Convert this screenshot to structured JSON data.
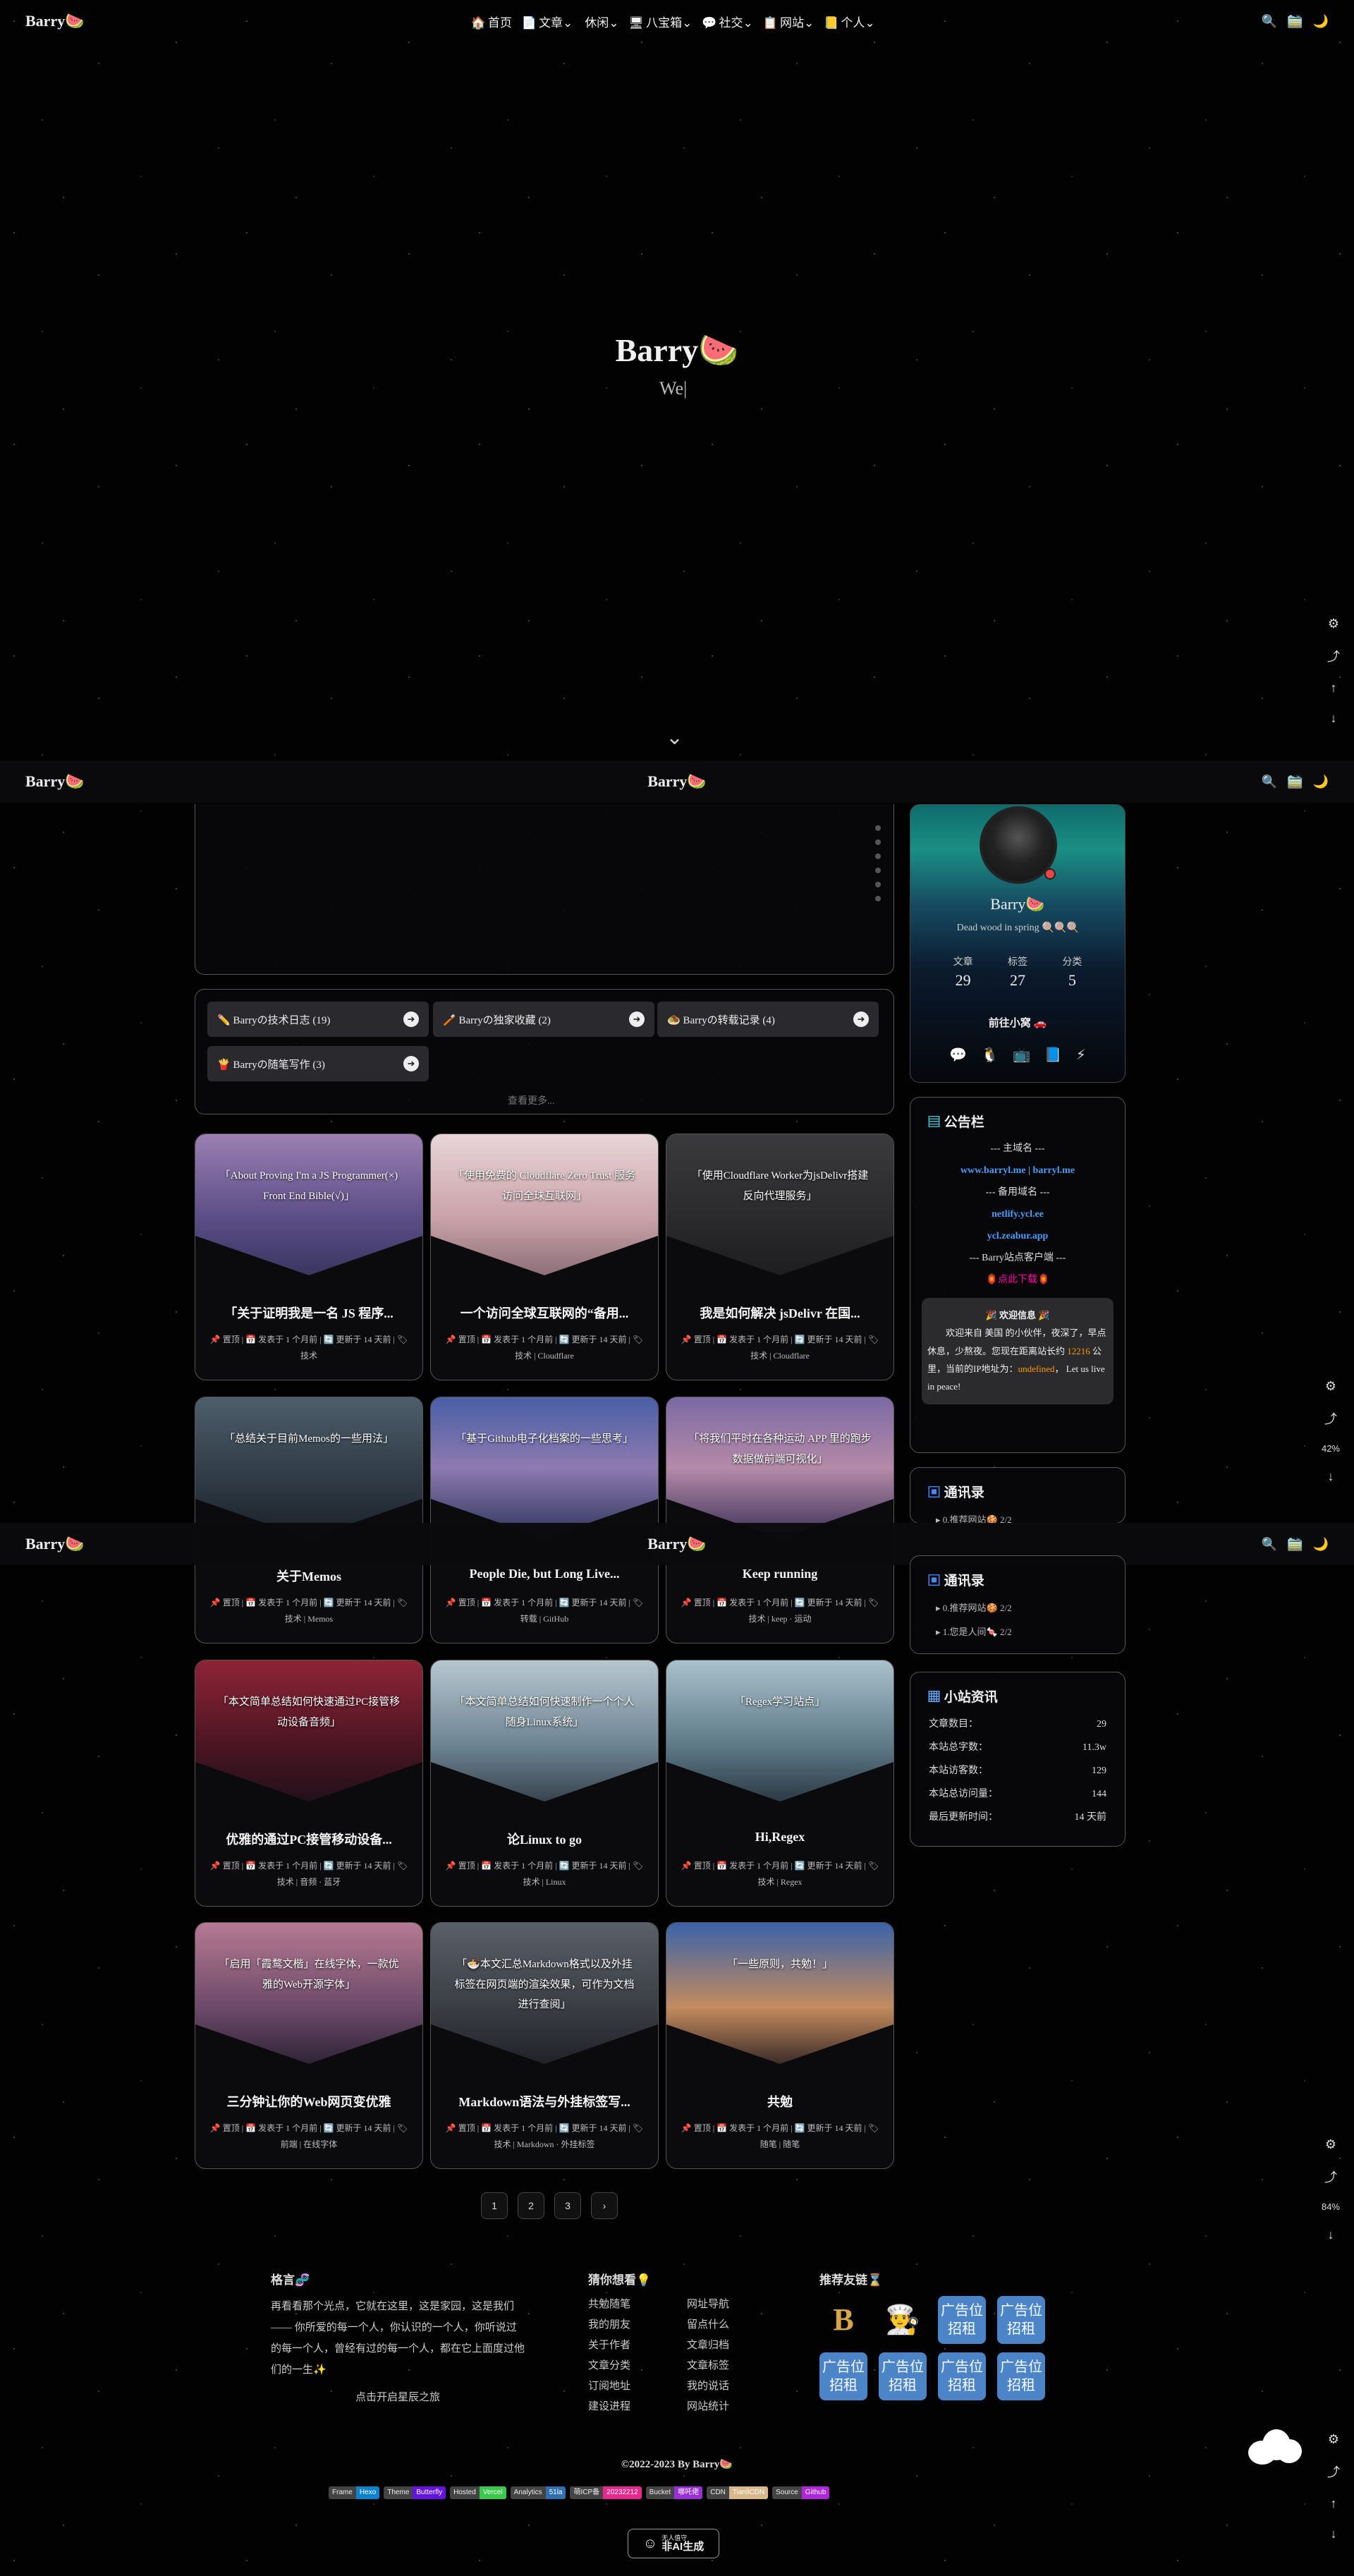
{
  "brand": "Barry🍉",
  "nav": {
    "items": [
      {
        "icon": "🏠",
        "label": "首页"
      },
      {
        "icon": "📄",
        "label": "文章"
      },
      {
        "icon": "",
        "label": "休闲"
      },
      {
        "icon": "🖥",
        "label": "八宝箱"
      },
      {
        "icon": "💬",
        "label": "社交"
      },
      {
        "icon": "📋",
        "label": "网站"
      },
      {
        "icon": "📒",
        "label": "个人"
      }
    ],
    "caret": "⌄",
    "search_icon": "🔍",
    "travel_icon": "🚞",
    "darkmode_icon": "🌙"
  },
  "hero": {
    "title": "Barry🍉",
    "subtitle": "We|",
    "down_arrow": "⌄"
  },
  "float": {
    "gear": "⚙",
    "share": "⤴",
    "up": "↑",
    "down": "↓",
    "pct1": "42%",
    "pct2": "84%"
  },
  "categories": [
    {
      "icon": "✏️",
      "label": "Barryの技术日志 (19)"
    },
    {
      "icon": "🪥",
      "label": "Barryの独家收藏 (2)"
    },
    {
      "icon": "🧆",
      "label": "Barryの转载记录 (4)"
    },
    {
      "icon": "🍟",
      "label": "Barryの随笔写作 (3)"
    }
  ],
  "category_arrow": "➜",
  "see_more": "查看更多...",
  "posts": [
    {
      "cover": "「About Proving I'm a JS Programmer(×) Front End Bible(√)」",
      "title": "「关于证明我是一名 JS 程序...",
      "tags": "技术",
      "bg": "linear-gradient(180deg,#9b7fb2,#5a4d86 60%,#39365f)"
    },
    {
      "cover": "「使用免费的 Cloudflare Zero Trust 服务访问全球互联网」",
      "title": "一个访问全球互联网的“备用...",
      "tags": "技术 | Cloudflare",
      "bg": "linear-gradient(180deg,#e8d5d8,#c9a2a8 60%,#8d6f78)"
    },
    {
      "cover": "「使用Cloudflare Worker为jsDelivr搭建反向代理服务」",
      "title": "我是如何解决 jsDelivr 在国...",
      "tags": "技术 | Cloudflare",
      "bg": "linear-gradient(180deg,#3a3a3c,#2a2a2c 60%,#1e1e20)"
    },
    {
      "cover": "「总结关于目前Memos的一些用法」",
      "title": "关于Memos",
      "tags": "技术 | Memos",
      "bg": "linear-gradient(180deg,#4d5d6a,#2e3a45 60%,#1a2028)"
    },
    {
      "cover": "「基于Github电子化档案的一些思考」",
      "title": "People Die, but Long Live...",
      "tags": "转载 | GitHub",
      "bg": "linear-gradient(180deg,#4a5fa6,#8d7ab0 50%,#2d355c)"
    },
    {
      "cover": "「将我们平时在各种运动 APP 里的跑步数据做前端可视化」",
      "title": "Keep running",
      "tags": "技术 | keep · 运动",
      "bg": "linear-gradient(180deg,#7b6aa4,#b58aa8 50%,#3b3158)"
    },
    {
      "cover": "「本文简单总结如何快速通过PC接管移动设备音频」",
      "title": "优雅的通过PC接管移动设备...",
      "tags": "技术 | 音频 · 蓝牙",
      "bg": "linear-gradient(180deg,#8e2436,#4b1522 60%,#22101a)"
    },
    {
      "cover": "「本文简单总结如何快速制作一个个人随身Linux系统」",
      "title": "论Linux to go",
      "tags": "技术 | Linux",
      "bg": "linear-gradient(180deg,#b7c6cf,#6d8492 60%,#37444e)"
    },
    {
      "cover": "「Regex学习站点」",
      "title": "Hi,Regex",
      "tags": "技术 | Regex",
      "bg": "linear-gradient(180deg,#a9c1cc,#5e7a88 60%,#2c3a44)"
    },
    {
      "cover": "「启用「霞鹜文楷」在线字体，一款优雅的Web开源字体」",
      "title": "三分钟让你的Web网页变优雅",
      "tags": "前端 | 在线字体",
      "bg": "linear-gradient(180deg,#b67a92,#6c4a69 60%,#2f2437)"
    },
    {
      "cover": "「🍜本文汇总Markdown格式以及外挂标签在网页端的渲染效果，可作为文档进行查阅」",
      "title": "Markdown语法与外挂标签写...",
      "tags": "技术 | Markdown · 外挂标签",
      "bg": "linear-gradient(180deg,#5a5f68,#3a3d44 60%,#202228)"
    },
    {
      "cover": "「一些原则，共勉！」",
      "title": "共勉",
      "tags": "随笔 | 随笔",
      "bg": "linear-gradient(180deg,#3b63a8,#c38b5e 60%,#3d2d2a)"
    }
  ],
  "post_meta": {
    "pin": "置顶",
    "posted": "发表于 1 个月前",
    "updated": "更新于 14 天前"
  },
  "pager": [
    "1",
    "2",
    "3",
    "›"
  ],
  "profile": {
    "name": "Barry🍉",
    "desc": "Dead wood in spring 🍭🍭🍭",
    "stats": [
      {
        "label": "文章",
        "value": "29"
      },
      {
        "label": "标签",
        "value": "27"
      },
      {
        "label": "分类",
        "value": "5"
      }
    ],
    "button": "前往小窝 🚗",
    "social": [
      "💬",
      "🐧",
      "📺",
      "📘",
      "⚡"
    ]
  },
  "announcement": {
    "title": "公告栏",
    "lines": [
      {
        "t": "--- 主域名 ---",
        "c": ""
      },
      {
        "t": "www.barryl.me | barryl.me",
        "c": "blue"
      },
      {
        "t": "--- 备用域名 ---",
        "c": ""
      },
      {
        "t": "netlify.ycl.ee",
        "c": "blue"
      },
      {
        "t": "ycl.zeabur.app",
        "c": "blue"
      },
      {
        "t": "--- Barry站点客户端 ---",
        "c": ""
      },
      {
        "t": "🏮点此下载🏮",
        "c": "pink"
      }
    ],
    "welcome_title": "🎉 欢迎信息 🎉",
    "welcome_text1": "欢迎来自 美国 的小伙伴，夜深了，早点休息，少熬夜。您现在距离站长约 ",
    "welcome_dist": "12216",
    "welcome_text2": " 公里，当前的IP地址为：",
    "welcome_ip": "undefined",
    "welcome_text3": "， Let us live in peace!"
  },
  "archive": {
    "title": "通讯录",
    "items": [
      "▸ 0.推荐网站🍪 2/2",
      "▸ 1.您是人间🍬 2/2"
    ]
  },
  "site_info": {
    "title": "小站资讯",
    "rows": [
      {
        "k": "文章数目：",
        "v": "29"
      },
      {
        "k": "本站总字数：",
        "v": "11.3w"
      },
      {
        "k": "本站访客数：",
        "v": "129"
      },
      {
        "k": "本站总访问量：",
        "v": "144"
      },
      {
        "k": "最后更新时间：",
        "v": "14 天前"
      }
    ]
  },
  "footer": {
    "quote_title": "格言🧬",
    "quote": "再看看那个光点，它就在这里，这是家园，这是我们 —— 你所爱的每一个人，你认识的一个人，你听说过的每一个人，曾经有过的每一个人，都在它上面度过他们的一生✨",
    "quote_link": "点击开启星辰之旅",
    "guess_title": "猜你想看💡",
    "links": [
      "共勉随笔",
      "网址导航",
      "我的朋友",
      "留点什么",
      "关于作者",
      "文章归档",
      "文章分类",
      "文章标签",
      "订阅地址",
      "我的说话",
      "建设进程",
      "网站统计"
    ],
    "friends_title": "推荐友链⌛",
    "ad_label": "广告位招租",
    "copyright": "©2022-2023  By Barry🍉",
    "badges": [
      {
        "l": "Frame",
        "r": "Hexo",
        "c": "#0e83cd"
      },
      {
        "l": "Theme",
        "r": "Butterfly",
        "c": "#6513df"
      },
      {
        "l": "Hosted",
        "r": "Vercel",
        "c": "#39c94b"
      },
      {
        "l": "Analytics",
        "r": "51la",
        "c": "#2f6fb0"
      },
      {
        "l": "萌ICP备",
        "r": "20232212",
        "c": "#e9278f"
      },
      {
        "l": "Bucket",
        "r": "哪吒佬",
        "c": "#9a2fd6"
      },
      {
        "l": "CDN",
        "r": "TianliCDN",
        "c": "#d9b88a"
      },
      {
        "l": "Source",
        "r": "Github",
        "c": "#b026d9"
      }
    ],
    "ai_top": "无人值守",
    "ai_label": "非AI生成"
  }
}
